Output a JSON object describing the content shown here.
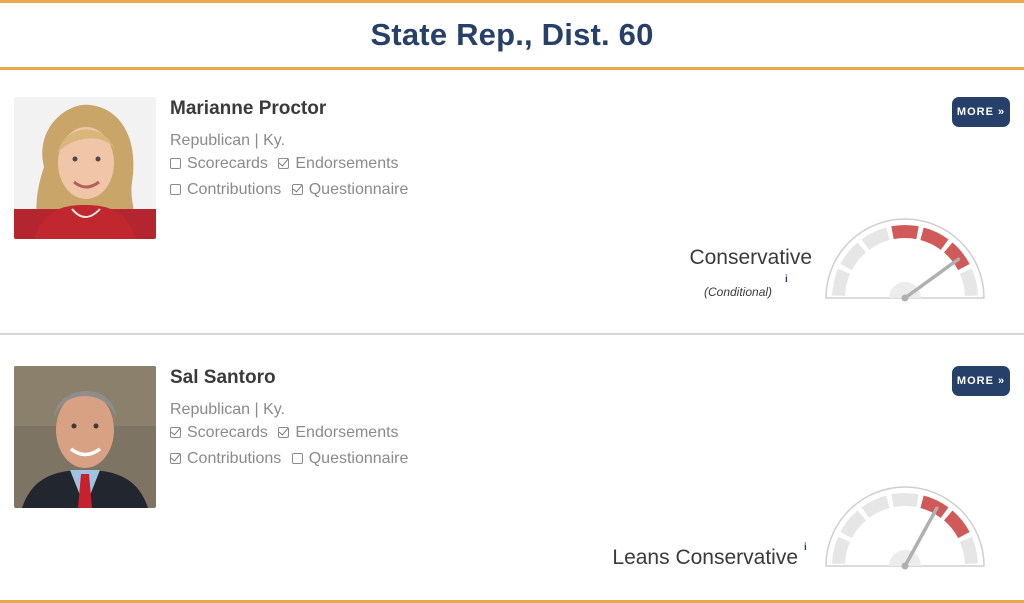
{
  "page": {
    "title": "State Rep., Dist. 60"
  },
  "candidates": [
    {
      "name": "Marianne Proctor",
      "party_state": "Republican | Ky.",
      "checks": [
        {
          "label": "Scorecards",
          "checked": false
        },
        {
          "label": "Endorsements",
          "checked": true
        },
        {
          "label": "Contributions",
          "checked": false
        },
        {
          "label": "Questionnaire",
          "checked": true
        }
      ],
      "more_label": "MORE »",
      "rating": "Conservative",
      "rating_note": "(Conditional)",
      "info_mark": "i",
      "gauge": {
        "highlighted_segments": 3,
        "total_segments": 7,
        "needle_level": 0.8
      }
    },
    {
      "name": "Sal Santoro",
      "party_state": "Republican | Ky.",
      "checks": [
        {
          "label": "Scorecards",
          "checked": true
        },
        {
          "label": "Endorsements",
          "checked": true
        },
        {
          "label": "Contributions",
          "checked": true
        },
        {
          "label": "Questionnaire",
          "checked": false
        }
      ],
      "more_label": "MORE »",
      "rating": "Leans Conservative",
      "rating_note": "",
      "info_mark": "i",
      "gauge": {
        "highlighted_segments": 2,
        "total_segments": 7,
        "needle_level": 0.66
      }
    }
  ],
  "colors": {
    "title": "#27406a",
    "accent_rule": "#e9a94a",
    "gauge_red": "#d05a5a",
    "gauge_grey": "#e6e6e6",
    "button": "#27406a"
  }
}
